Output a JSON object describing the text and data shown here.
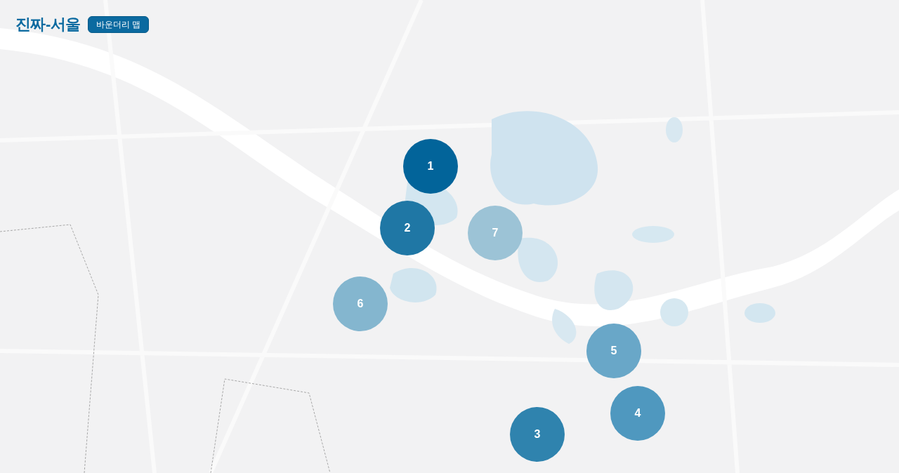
{
  "header": {
    "title": "진짜-서울",
    "badge": "바운더리 맵"
  },
  "markers": [
    {
      "label": "1",
      "color": "#02649a"
    },
    {
      "label": "2",
      "color": "#1f77a5"
    },
    {
      "label": "3",
      "color": "#2f83ae"
    },
    {
      "label": "4",
      "color": "#4f98bf"
    },
    {
      "label": "5",
      "color": "#69a7c8"
    },
    {
      "label": "6",
      "color": "#84b6cf"
    },
    {
      "label": "7",
      "color": "#9cc3d6"
    }
  ]
}
